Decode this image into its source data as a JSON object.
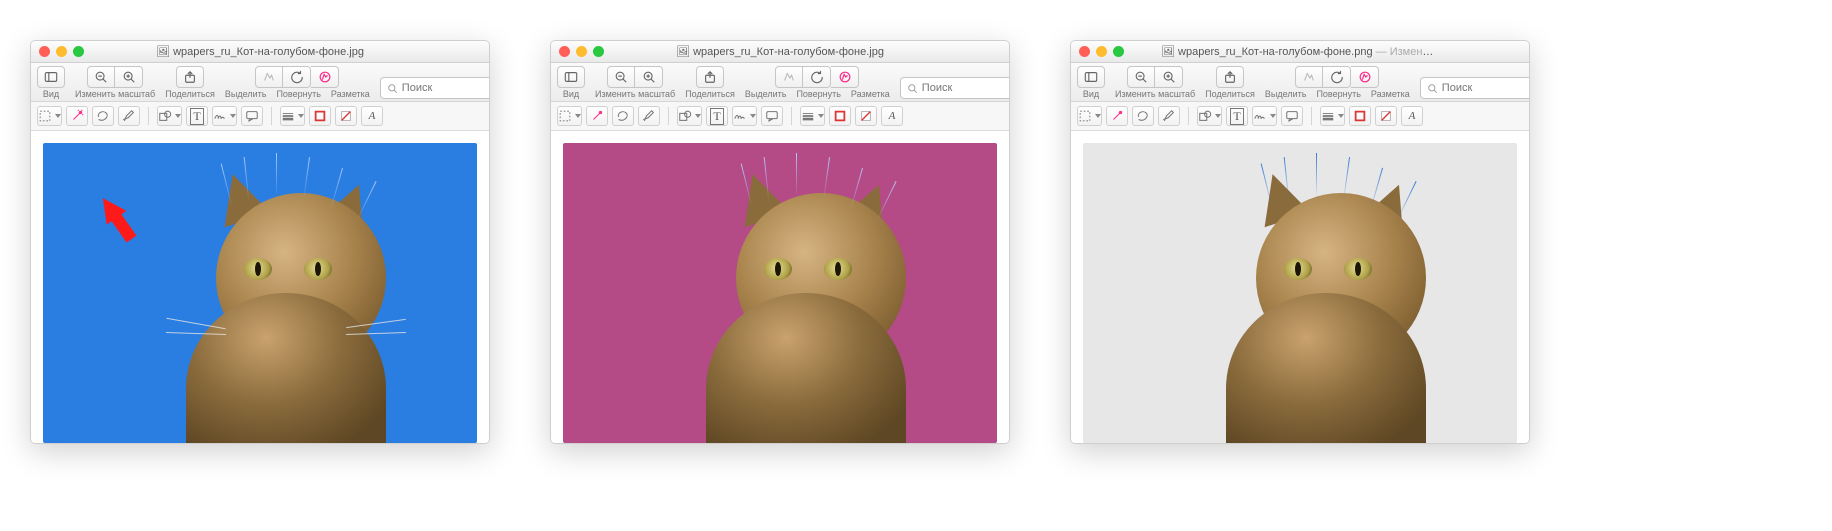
{
  "windows": [
    {
      "title": "wpapers_ru_Кот-на-голубом-фоне.jpg",
      "title_suffix": "",
      "bg_class": "bg-blue",
      "show_arrow": true
    },
    {
      "title": "wpapers_ru_Кот-на-голубом-фоне.jpg",
      "title_suffix": "",
      "bg_class": "bg-magenta",
      "show_arrow": false
    },
    {
      "title": "wpapers_ru_Кот-на-голубом-фоне.png",
      "title_suffix": " — Изменено",
      "bg_class": "bg-trans",
      "show_arrow": false
    }
  ],
  "toolbar": {
    "view_label": "Вид",
    "zoom_label": "Изменить масштаб",
    "share_label": "Поделиться",
    "highlight_label": "Выделить",
    "rotate_label": "Повернуть",
    "markup_label": "Разметка",
    "search_placeholder": "Поиск"
  },
  "icons": {
    "sidebar": "sidebar-icon",
    "zoom_out": "zoom-out-icon",
    "zoom_in": "zoom-in-icon",
    "share": "share-icon",
    "highlight": "highlight-icon",
    "rotate": "rotate-icon",
    "markup": "markup-icon",
    "search": "search-icon",
    "selection": "selection-rect-icon",
    "wand": "magic-wand-icon",
    "lasso": "lasso-icon",
    "pen": "pen-icon",
    "shapes": "shapes-icon",
    "text": "text-tool-icon",
    "signature": "signature-icon",
    "callout": "callout-icon",
    "line_style": "line-style-icon",
    "stroke_color": "stroke-color-icon",
    "fill_color": "fill-color-icon",
    "font": "font-style-icon"
  }
}
